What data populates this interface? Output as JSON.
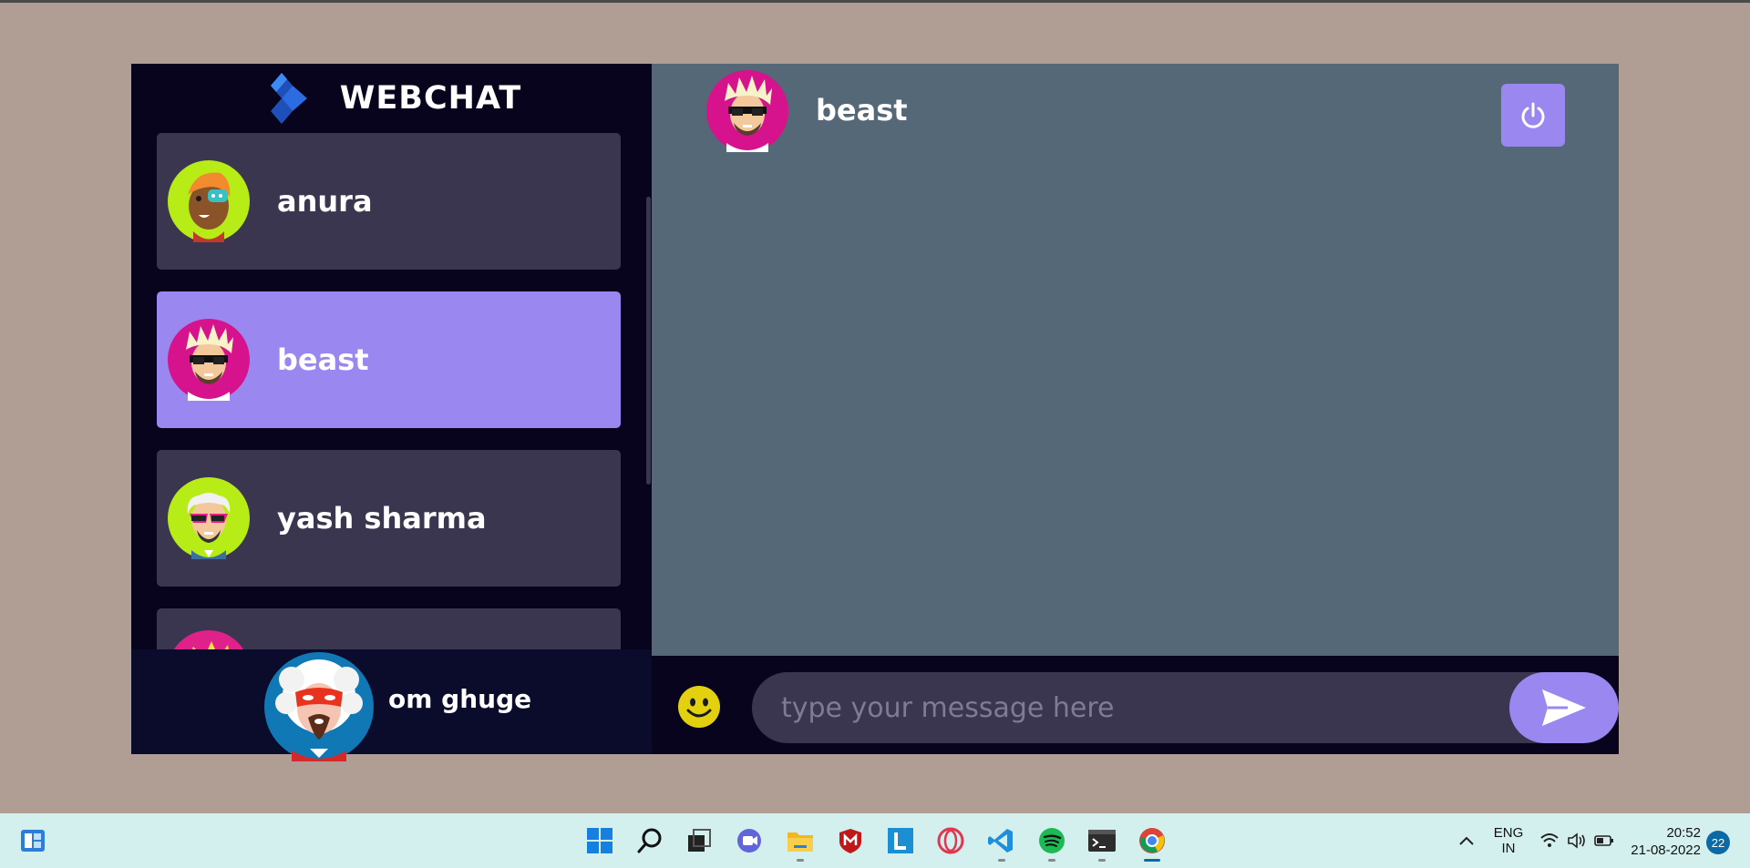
{
  "app": {
    "brand": "WEBCHAT",
    "contacts": [
      {
        "name": "anura",
        "avatar": "avatar-anura",
        "active": false
      },
      {
        "name": "beast",
        "avatar": "avatar-beast",
        "active": true
      },
      {
        "name": "yash sharma",
        "avatar": "avatar-yash",
        "active": false
      },
      {
        "name": "",
        "avatar": "avatar-partial",
        "active": false
      }
    ],
    "current_user": {
      "name": "om ghuge",
      "avatar": "avatar-om"
    },
    "chat": {
      "recipient": "beast",
      "logout_icon": "power-icon",
      "input_placeholder": "type your message here",
      "emoji_icon": "emoji-icon",
      "send_icon": "send-icon"
    },
    "colors": {
      "sidebar_bg": "#08041e",
      "card_bg": "#3a3650",
      "accent": "#9a87f0",
      "chat_bg": "#546877"
    }
  },
  "taskbar": {
    "apps": [
      "widgets-icon",
      "start-icon",
      "search-icon",
      "task-view-icon",
      "teams-icon",
      "file-explorer-icon",
      "mcafee-icon",
      "l-app-icon",
      "opera-icon",
      "vscode-icon",
      "spotify-icon",
      "terminal-icon",
      "chrome-icon"
    ],
    "language_line1": "ENG",
    "language_line2": "IN",
    "time": "20:52",
    "date": "21-08-2022",
    "notifications": "22"
  }
}
